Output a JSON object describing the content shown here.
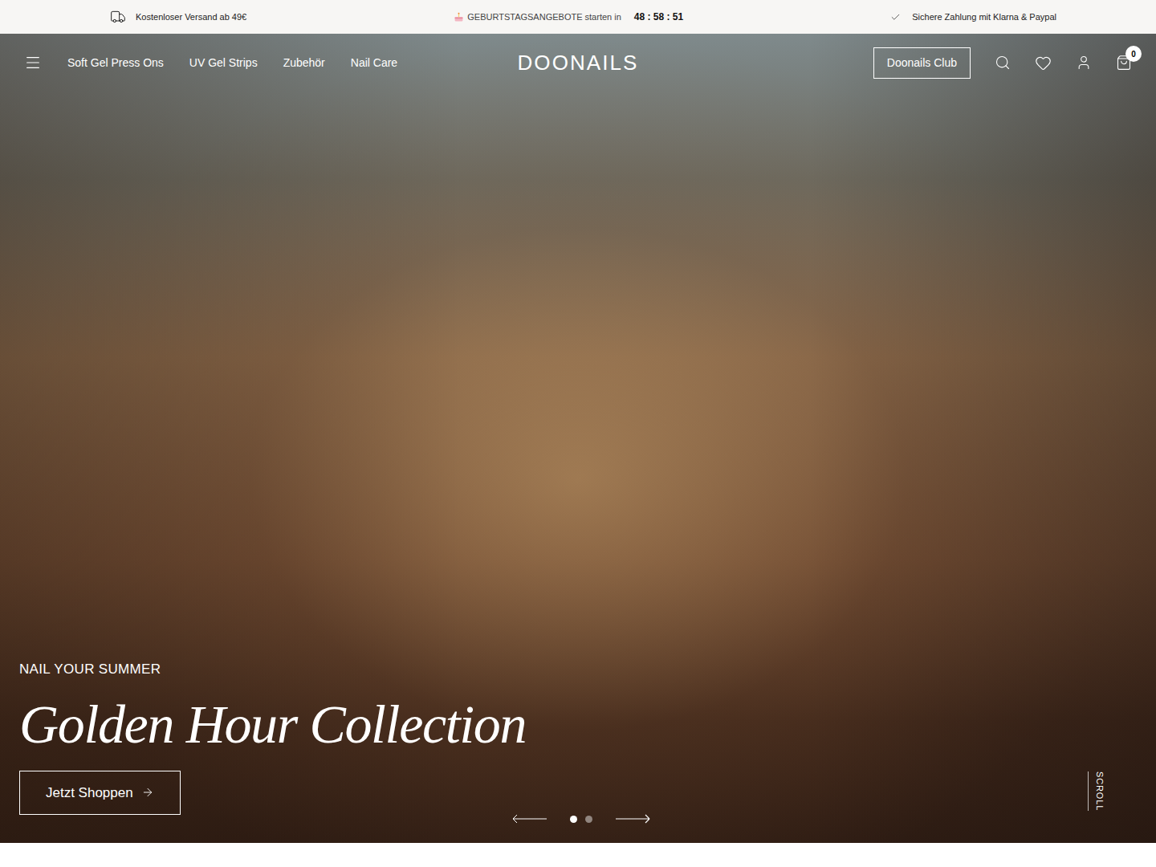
{
  "announcement_bar": {
    "shipping": "Kostenloser Versand ab 49€",
    "promo": "GEBURTSTAGSANGEBOTE starten in",
    "countdown": "48 : 58 : 51",
    "payment": "Sichere Zahlung mit Klarna & Paypal"
  },
  "header": {
    "menu_items": [
      "Soft Gel Press Ons",
      "UV Gel Strips",
      "Zubehör",
      "Nail Care"
    ],
    "logo": "DOONAILS",
    "club_button": "Doonails Club",
    "cart_count": "0"
  },
  "hero": {
    "eyebrow": "NAIL YOUR SUMMER",
    "title": "Golden Hour Collection",
    "cta": "Jetzt Shoppen",
    "slides": [
      {
        "selected": true
      },
      {
        "selected": false
      }
    ],
    "scroll_label": "SCROLL"
  }
}
